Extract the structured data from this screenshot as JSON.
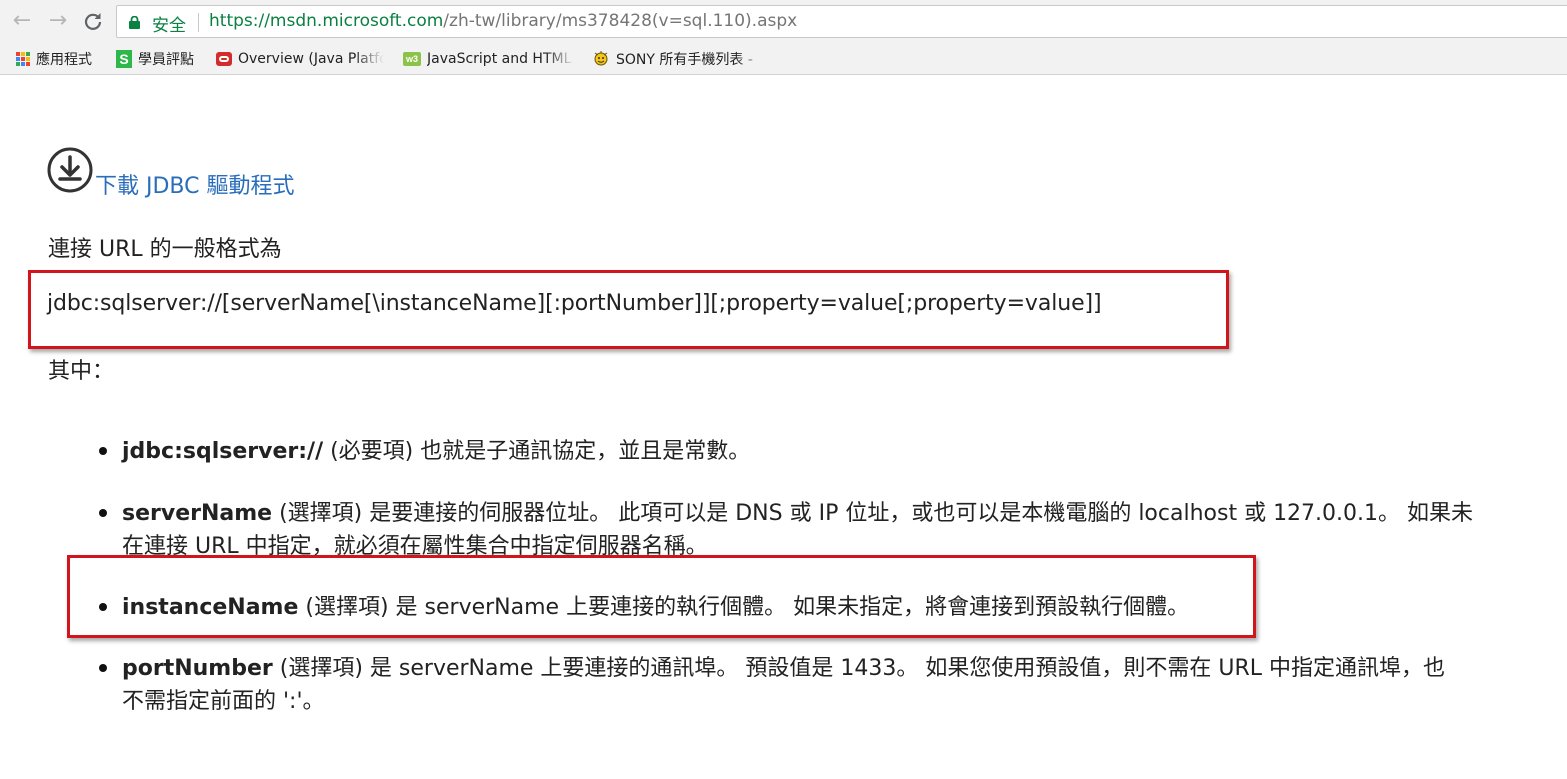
{
  "browser": {
    "secure_label": "安全",
    "url_host": "https://msdn.microsoft.com",
    "url_path": "/zh-tw/library/ms378428(v=sql.110).aspx",
    "bookmarks": [
      {
        "label": "應用程式",
        "icon": "apps-grid-icon"
      },
      {
        "label": "學員評點",
        "icon": "s-logo-icon"
      },
      {
        "label": "Overview (Java Platfo",
        "icon": "oracle-icon"
      },
      {
        "label": "JavaScript and HTML",
        "icon": "w3-icon"
      },
      {
        "label": "SONY 所有手機列表 -",
        "icon": "sony-icon"
      }
    ]
  },
  "content": {
    "download_link": "下載 JDBC 驅動程式",
    "intro": "連接 URL 的一般格式為",
    "url_format": "jdbc:sqlserver://[serverName[\\instanceName][:portNumber]][;property=value[;property=value]]",
    "where": "其中：",
    "items": [
      {
        "term": "jdbc:sqlserver://",
        "lines": [
          " (必要項) 也就是子通訊協定，並且是常數。"
        ]
      },
      {
        "term": "serverName",
        "lines": [
          " (選擇項) 是要連接的伺服器位址。 此項可以是 DNS 或 IP 位址，或也可以是本機電腦的 localhost 或 127.0.0.1。 如果未",
          "在連接 URL 中指定，就必須在屬性集合中指定伺服器名稱。"
        ]
      },
      {
        "term": "instanceName",
        "lines": [
          " (選擇項) 是 serverName 上要連接的執行個體。 如果未指定，將會連接到預設執行個體。"
        ]
      },
      {
        "term": "portNumber",
        "lines": [
          " (選擇項) 是 serverName 上要連接的通訊埠。 預設值是 1433。 如果您使用預設值，則不需在 URL 中指定通訊埠，也",
          "不需指定前面的 ':'。"
        ]
      }
    ]
  },
  "colors": {
    "link": "#2a6ebb",
    "highlight_box": "#d0151b",
    "secure": "#0b8043"
  }
}
